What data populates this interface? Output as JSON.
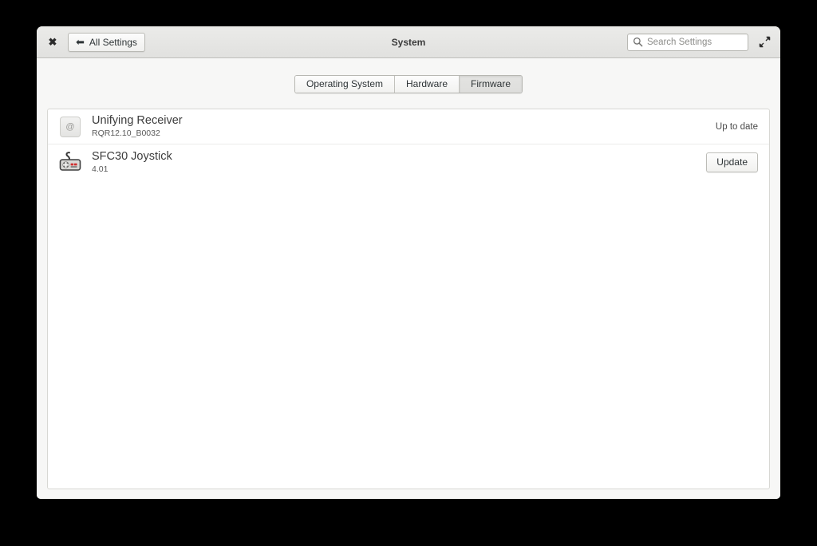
{
  "window": {
    "title": "System",
    "close_icon": "close-icon",
    "maximize_icon": "maximize-icon"
  },
  "header": {
    "back_button_label": "All Settings",
    "back_arrow_icon": "arrow-left-icon",
    "search": {
      "icon": "search-icon",
      "value": "",
      "placeholder": "Search Settings"
    }
  },
  "tabs": [
    {
      "label": "Operating System",
      "selected": false
    },
    {
      "label": "Hardware",
      "selected": false
    },
    {
      "label": "Firmware",
      "selected": true
    }
  ],
  "devices": [
    {
      "icon": "generic-device-icon",
      "name": "Unifying Receiver",
      "version": "RQR12.10_B0032",
      "status_label": "Up to date",
      "action_label": ""
    },
    {
      "icon": "gamepad-icon",
      "name": "SFC30 Joystick",
      "version": "4.01",
      "status_label": "",
      "action_label": "Update"
    }
  ]
}
